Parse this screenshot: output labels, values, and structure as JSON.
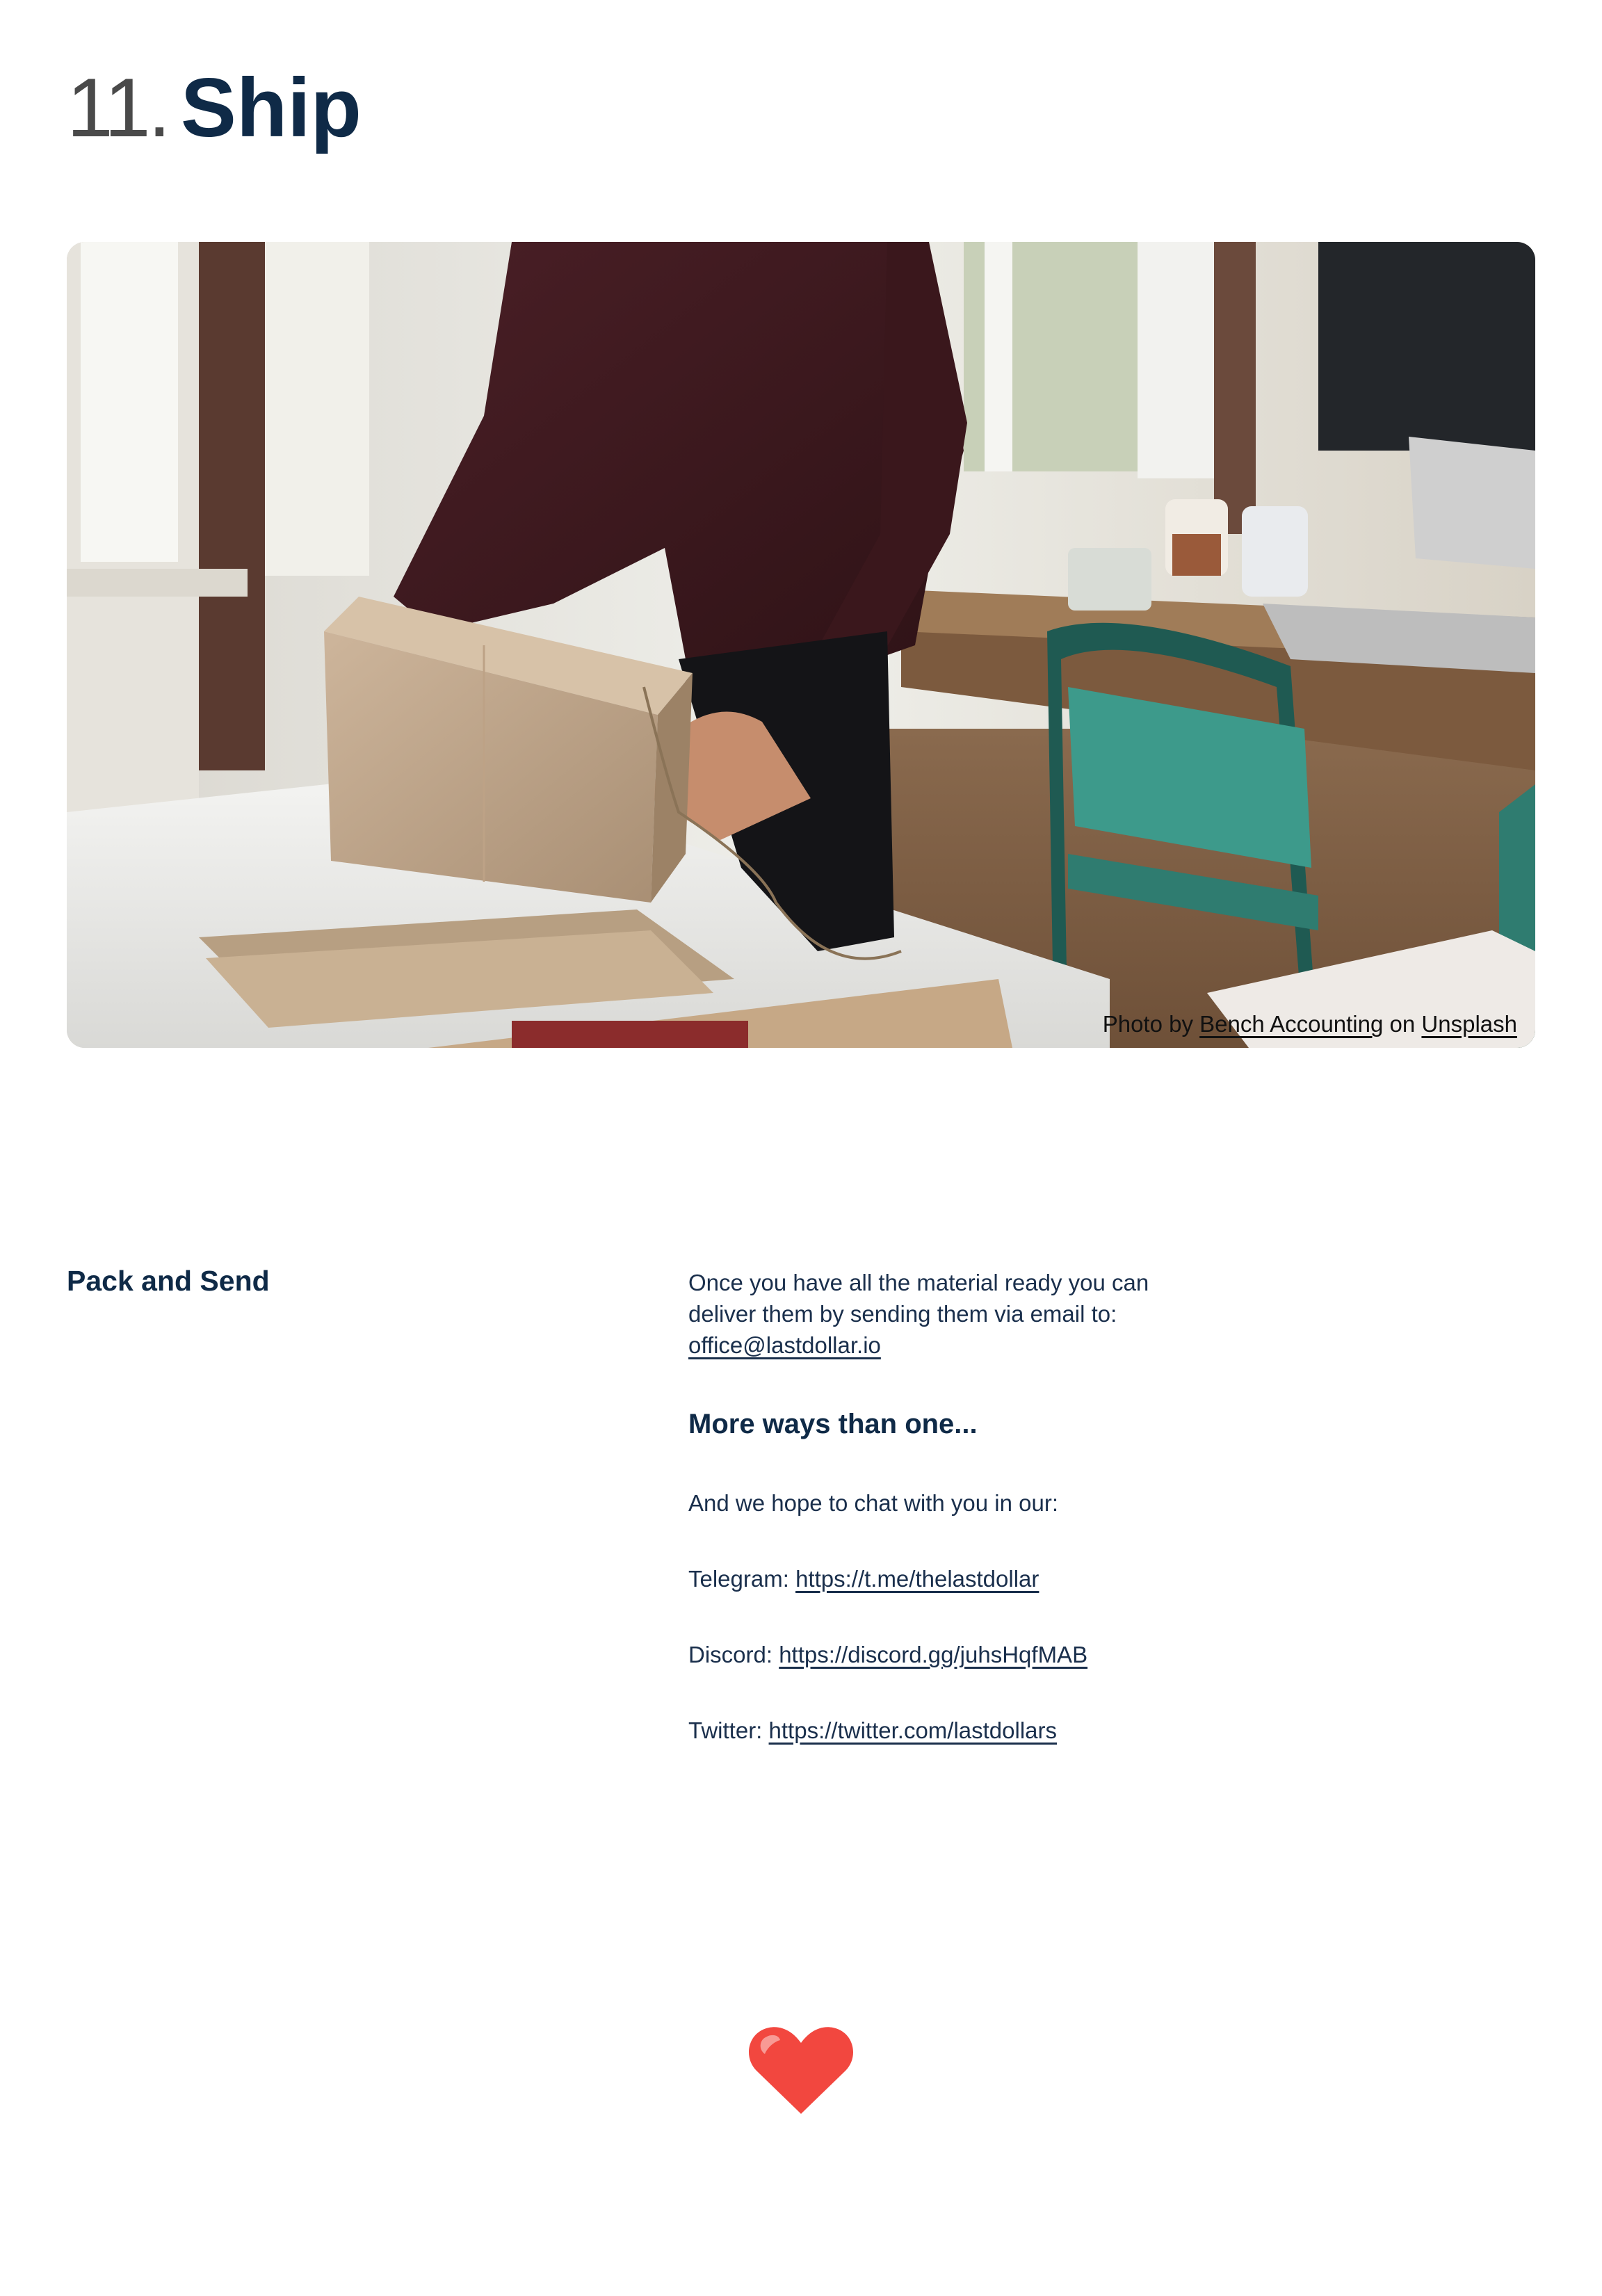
{
  "header": {
    "number": "11.",
    "word": "Ship"
  },
  "hero": {
    "image_alt": "Person packing a cardboard box on a white table in a bright office",
    "credit": {
      "prefix": "Photo by",
      "author": "Bench Accounting",
      "on": "on",
      "source": "Unsplash"
    }
  },
  "section": {
    "title": "Pack and Send",
    "intro_text": "Once you have all the material ready you can deliver them by sending them via email to:",
    "email": "office@lastdollar.io",
    "subheading": "More ways than one...",
    "chat_intro": "And we hope to chat with you in our:",
    "channels": [
      {
        "label": "Telegram:",
        "url": "https://t.me/thelastdollar"
      },
      {
        "label": "Discord:",
        "url": "https://discord.gg/juhsHqfMAB"
      },
      {
        "label": "Twitter:",
        "url": "https://twitter.com/lastdollars"
      }
    ]
  },
  "footer": {
    "icon": "heart-icon",
    "heart_color": "#f2473f"
  },
  "colors": {
    "heading": "#0f2a47",
    "number": "#4a4a4a",
    "body_text": "#1a2f4c"
  }
}
